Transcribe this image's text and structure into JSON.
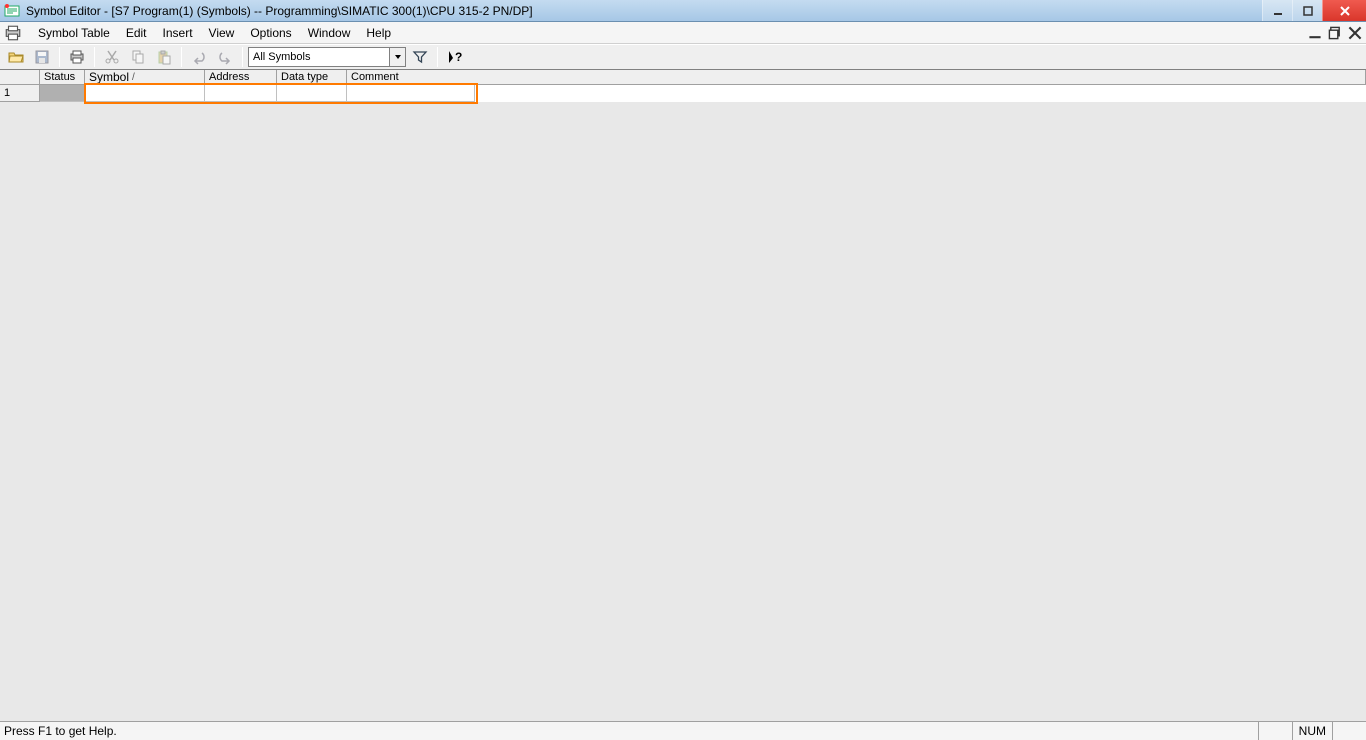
{
  "titlebar": {
    "text": "Symbol Editor - [S7 Program(1) (Symbols) -- Programming\\SIMATIC 300(1)\\CPU 315-2 PN/DP]"
  },
  "menubar": {
    "items": [
      "Symbol Table",
      "Edit",
      "Insert",
      "View",
      "Options",
      "Window",
      "Help"
    ]
  },
  "toolbar": {
    "filter_combo": "All Symbols"
  },
  "grid": {
    "headers": {
      "status": "Status",
      "symbol": "Symbol",
      "address": "Address",
      "datatype": "Data type",
      "comment": "Comment"
    },
    "rows": [
      {
        "num": "1",
        "status": "",
        "symbol": "",
        "address": "",
        "datatype": "",
        "comment": ""
      }
    ]
  },
  "statusbar": {
    "help": "Press F1 to get Help.",
    "num": "NUM"
  }
}
